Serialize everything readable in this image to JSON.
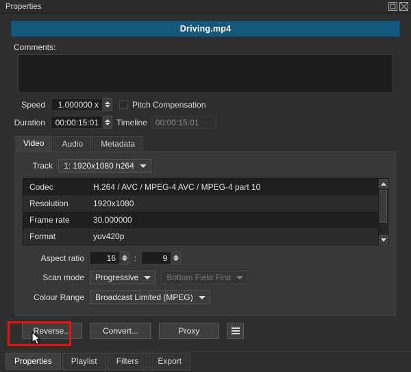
{
  "window": {
    "title": "Properties",
    "float_icon": "float-icon",
    "close_icon": "close-icon"
  },
  "file_banner": {
    "name": "Driving.mp4"
  },
  "comments": {
    "label": "Comments:",
    "value": "",
    "placeholder": ""
  },
  "speed": {
    "label": "Speed",
    "value": "1.000000 x",
    "pitch_compensation_label": "Pitch Compensation",
    "pitch_compensation_checked": false
  },
  "duration": {
    "label": "Duration",
    "value": "00:00:15:01",
    "timeline_label": "Timeline",
    "timeline_value": "00:00:15:01",
    "timeline_disabled": true
  },
  "tabs": [
    {
      "label": "Video",
      "active": true
    },
    {
      "label": "Audio",
      "active": false
    },
    {
      "label": "Metadata",
      "active": false
    }
  ],
  "track": {
    "label": "Track",
    "value": "1: 1920x1080 h264"
  },
  "properties_table": {
    "rows": [
      {
        "key": "Codec",
        "value": "H.264 / AVC / MPEG-4 AVC / MPEG-4 part 10"
      },
      {
        "key": "Resolution",
        "value": "1920x1080"
      },
      {
        "key": "Frame rate",
        "value": "30.000000"
      },
      {
        "key": "Format",
        "value": "yuv420p"
      }
    ],
    "scroll_up_icon": "scroll-up-icon",
    "scroll_down_icon": "scroll-down-icon"
  },
  "aspect_ratio": {
    "label": "Aspect ratio",
    "numerator": "16",
    "separator": ":",
    "denominator": "9"
  },
  "scan_mode": {
    "label": "Scan mode",
    "value": "Progressive",
    "field_order_value": "Bottom Field First",
    "field_order_disabled": true
  },
  "colour_range": {
    "label": "Colour Range",
    "value": "Broadcast Limited (MPEG)"
  },
  "action_buttons": {
    "reverse": "Reverse...",
    "convert": "Convert...",
    "proxy": "Proxy",
    "menu_icon": "hamburger-menu-icon"
  },
  "bottom_tabs": [
    {
      "label": "Properties",
      "active": true
    },
    {
      "label": "Playlist",
      "active": false
    },
    {
      "label": "Filters",
      "active": false
    },
    {
      "label": "Export",
      "active": false
    }
  ],
  "annotation": {
    "highlight_color": "#ee1111",
    "target": "Reverse..."
  },
  "colors": {
    "accent_banner": "#15587d",
    "window_bg": "#2e2e2e",
    "panel_bg": "#373737",
    "field_bg": "#1d1d1d",
    "highlight": "#ee1111"
  }
}
